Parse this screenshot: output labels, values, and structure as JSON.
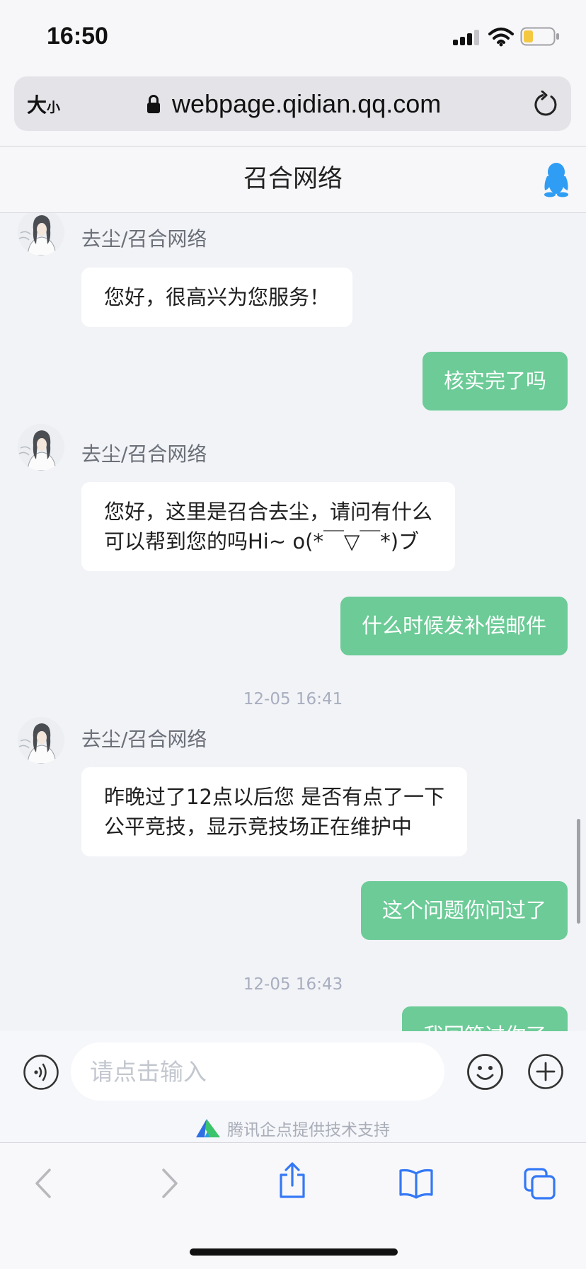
{
  "status_bar": {
    "time": "16:50"
  },
  "address_bar": {
    "text_size_large": "大",
    "text_size_small": "小",
    "url": "webpage.qidian.qq.com"
  },
  "header": {
    "title": "召合网络"
  },
  "conversation": [
    {
      "agent": {
        "name": "去尘/召合网络",
        "lines": [
          "您好，很高兴为您服务！"
        ]
      }
    },
    {
      "user": "核实完了吗"
    },
    {
      "agent": {
        "name": "去尘/召合网络",
        "lines": [
          "您好，这里是召合去尘，请问有什么",
          "可以帮到您的吗Hi~ o(*￣▽￣*)ブ"
        ]
      }
    },
    {
      "user": "什么时候发补偿邮件"
    },
    {
      "time": "12-05 16:41"
    },
    {
      "agent": {
        "name": "去尘/召合网络",
        "lines": [
          "昨晚过了12点以后您 是否有点了一下",
          "公平竞技，显示竞技场正在维护中"
        ]
      }
    },
    {
      "user": "这个问题你问过了"
    },
    {
      "time": "12-05 16:43"
    },
    {
      "user": "我回答过你了"
    }
  ],
  "composer": {
    "placeholder": "请点击输入"
  },
  "footer": {
    "powered_by": "腾讯企点提供技术支持"
  },
  "colors": {
    "outgoing": "#6ccb97",
    "incoming": "#ffffff",
    "chat-bg": "#f2f3f7",
    "accent": "#3478f6",
    "qq-blue": "#2f9df4"
  }
}
